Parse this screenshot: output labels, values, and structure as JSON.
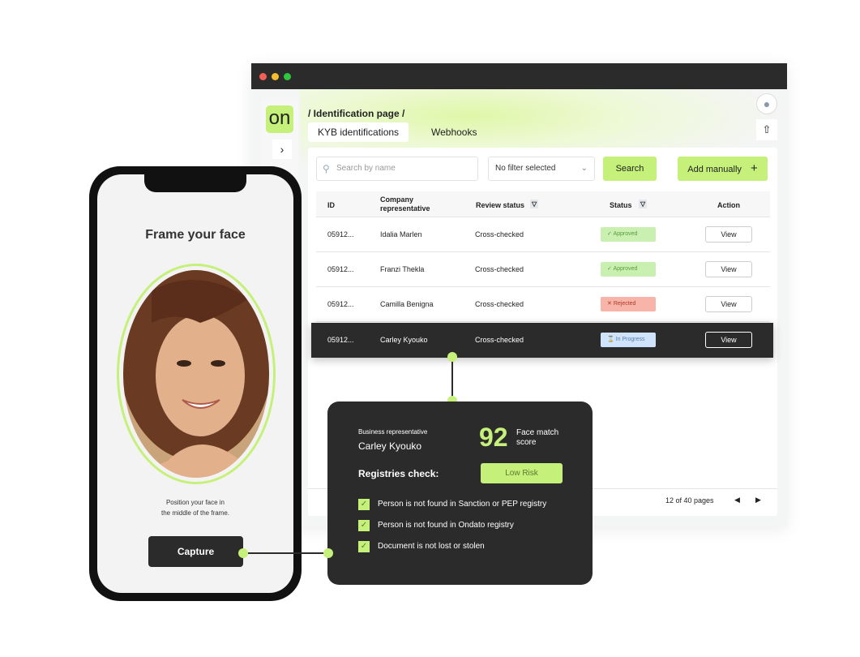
{
  "window": {
    "breadcrumb": "/ Identification page /",
    "logo": "on",
    "tabs": [
      {
        "label": "KYB identifications",
        "active": true
      },
      {
        "label": "Webhooks",
        "active": false
      }
    ]
  },
  "toolbar": {
    "search_placeholder": "Search by name",
    "filter_value": "No filter selected",
    "search_label": "Search",
    "add_label": "Add manually"
  },
  "table": {
    "headers": {
      "id": "ID",
      "rep": "Company representative",
      "review": "Review status",
      "status": "Status",
      "action": "Action"
    },
    "rows": [
      {
        "id": "05912...",
        "name": "Idalia Marlen",
        "review": "Cross-checked",
        "status": "Approved",
        "action": "View"
      },
      {
        "id": "05912...",
        "name": "Franzi Thekla",
        "review": "Cross-checked",
        "status": "Approved",
        "action": "View"
      },
      {
        "id": "05912...",
        "name": "Camilla Benigna",
        "review": "Cross-checked",
        "status": "Rejected",
        "action": "View"
      },
      {
        "id": "05912...",
        "name": "Carley Kyouko",
        "review": "Cross-checked",
        "status": "In Progress",
        "action": "View"
      }
    ],
    "pagination": "12 of 40 pages"
  },
  "phone": {
    "title": "Frame your face",
    "hint_line1": "Position your face in",
    "hint_line2": "the middle of the frame.",
    "capture_label": "Capture"
  },
  "popover": {
    "label": "Business representative",
    "name": "Carley Kyouko",
    "score": "92",
    "score_label_1": "Face match",
    "score_label_2": "score",
    "registries_label": "Registries check:",
    "risk": "Low Risk",
    "checks": [
      "Person is not found in Sanction or PEP registry",
      "Person is not found in Ondato registry",
      "Document is not lost or stolen"
    ]
  },
  "colors": {
    "accent": "#c5f07a",
    "dark": "#2b2b2b",
    "approved": "#c9f0b0",
    "rejected": "#f8b4a8",
    "progress": "#cfe3fa"
  }
}
